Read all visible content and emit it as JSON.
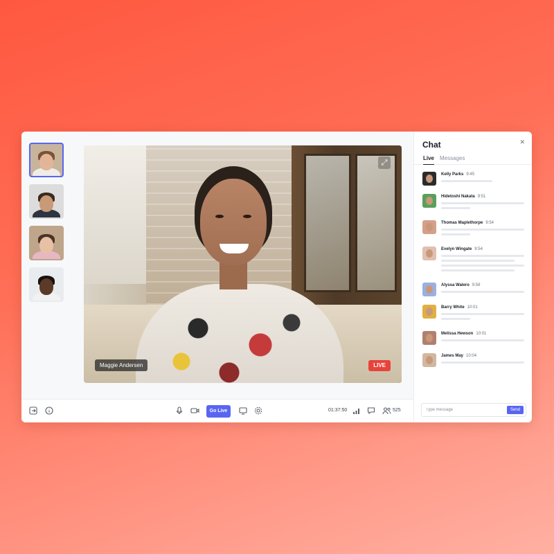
{
  "participants": [
    {
      "id": "p1",
      "active": true,
      "bg": "#c8b49c",
      "skin": "#e3b598",
      "hair": "#7a5234",
      "shirt": "#f0ede8"
    },
    {
      "id": "p2",
      "active": false,
      "bg": "#dcdcdc",
      "skin": "#c99a78",
      "hair": "#3a2a20",
      "shirt": "#2e3440"
    },
    {
      "id": "p3",
      "active": false,
      "bg": "#bfa58a",
      "skin": "#e7c0a6",
      "hair": "#4a3424",
      "shirt": "#e8b7c4"
    },
    {
      "id": "p4",
      "active": false,
      "bg": "#e9ecef",
      "skin": "#5b3a28",
      "hair": "#1a120e",
      "shirt": "#f2f2f2"
    }
  ],
  "video": {
    "speaker_name": "Maggie Andersen",
    "live_label": "LIVE"
  },
  "toolbar": {
    "go_live_label": "Go Live",
    "timer": "01:37:50",
    "viewer_count": "525"
  },
  "chat": {
    "title": "Chat",
    "tabs": [
      {
        "label": "Live",
        "active": true
      },
      {
        "label": "Messages",
        "active": false
      }
    ],
    "messages": [
      {
        "name": "Kelly Parks",
        "time": "9:45",
        "avatar_color": "#2b2b2b",
        "lines": [
          0.62
        ]
      },
      {
        "name": "Hidetoshi Nakata",
        "time": "9:51",
        "avatar_color": "#5aa05a",
        "lines": [
          1.0,
          0.35
        ]
      },
      {
        "name": "Thomas Maplethorpe",
        "time": "9:54",
        "avatar_color": "#d4a08a",
        "lines": [
          1.0,
          0.35
        ]
      },
      {
        "name": "Evelyn Wingate",
        "time": "9:54",
        "avatar_color": "#e0c0b0",
        "lines": [
          1.0,
          0.88,
          1.0,
          0.88
        ]
      },
      {
        "name": "Alyssa Walero",
        "time": "9:58",
        "avatar_color": "#9ab0e0",
        "lines": [
          1.0
        ]
      },
      {
        "name": "Barry White",
        "time": "10:01",
        "avatar_color": "#e0b040",
        "lines": [
          1.0,
          0.35
        ]
      },
      {
        "name": "Melissa Hewson",
        "time": "10:01",
        "avatar_color": "#b08070",
        "lines": [
          1.0
        ]
      },
      {
        "name": "James May",
        "time": "10:04",
        "avatar_color": "#d0b8a0",
        "lines": [
          1.0
        ]
      }
    ],
    "composer_placeholder": "Type message",
    "send_label": "Send"
  }
}
